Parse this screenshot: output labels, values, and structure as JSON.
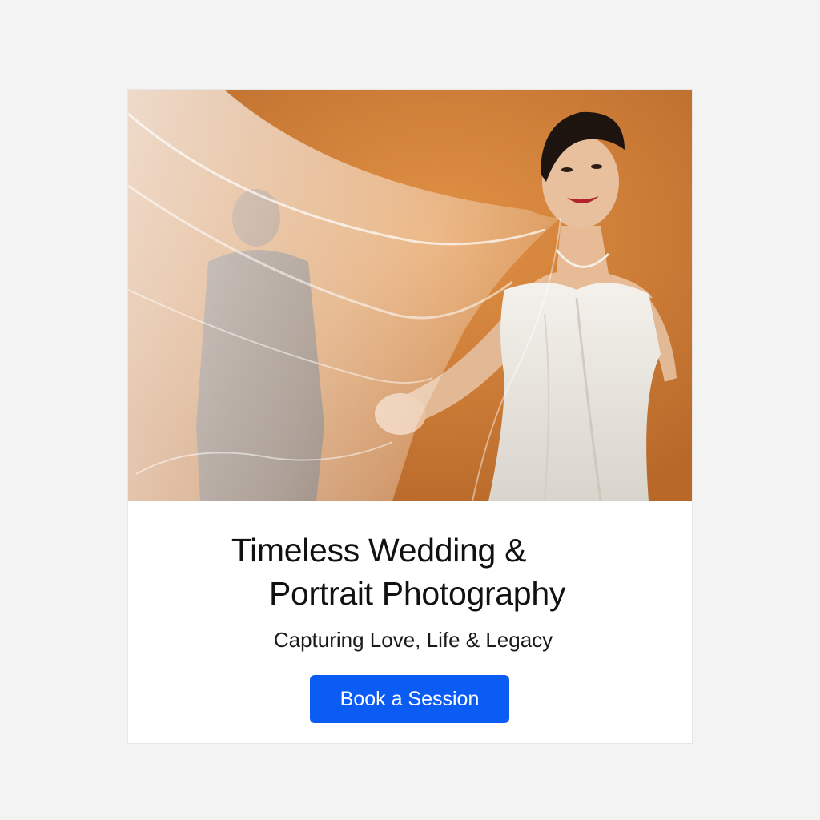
{
  "hero": {
    "image_alt": "Bride in white gown holding a flowing veil against an orange backdrop, with a groom blurred behind the veil"
  },
  "card": {
    "title_line1": "Timeless Wedding &",
    "title_line2": "Portrait Photography",
    "subtitle": "Capturing Love, Life & Legacy",
    "cta_label": "Book a Session"
  },
  "colors": {
    "page_background": "#f3f3f3",
    "card_background": "#ffffff",
    "accent": "#0a5cf5",
    "backdrop": "#d88a3a"
  }
}
